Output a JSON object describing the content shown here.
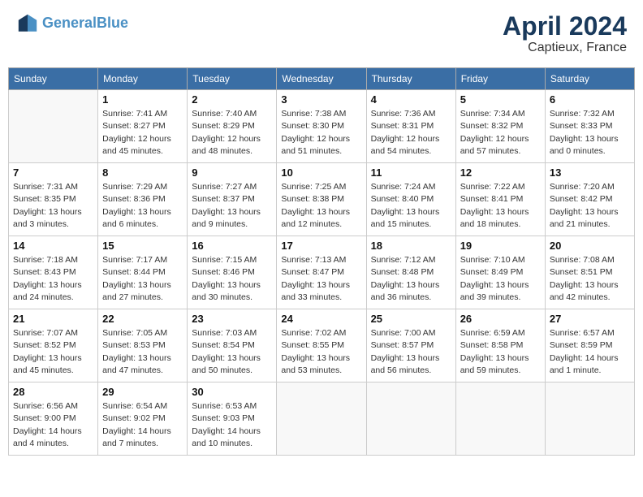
{
  "header": {
    "logo_line1": "General",
    "logo_line2": "Blue",
    "month_year": "April 2024",
    "location": "Captieux, France"
  },
  "weekdays": [
    "Sunday",
    "Monday",
    "Tuesday",
    "Wednesday",
    "Thursday",
    "Friday",
    "Saturday"
  ],
  "weeks": [
    [
      {
        "day": "",
        "info": ""
      },
      {
        "day": "1",
        "info": "Sunrise: 7:41 AM\nSunset: 8:27 PM\nDaylight: 12 hours\nand 45 minutes."
      },
      {
        "day": "2",
        "info": "Sunrise: 7:40 AM\nSunset: 8:29 PM\nDaylight: 12 hours\nand 48 minutes."
      },
      {
        "day": "3",
        "info": "Sunrise: 7:38 AM\nSunset: 8:30 PM\nDaylight: 12 hours\nand 51 minutes."
      },
      {
        "day": "4",
        "info": "Sunrise: 7:36 AM\nSunset: 8:31 PM\nDaylight: 12 hours\nand 54 minutes."
      },
      {
        "day": "5",
        "info": "Sunrise: 7:34 AM\nSunset: 8:32 PM\nDaylight: 12 hours\nand 57 minutes."
      },
      {
        "day": "6",
        "info": "Sunrise: 7:32 AM\nSunset: 8:33 PM\nDaylight: 13 hours\nand 0 minutes."
      }
    ],
    [
      {
        "day": "7",
        "info": "Sunrise: 7:31 AM\nSunset: 8:35 PM\nDaylight: 13 hours\nand 3 minutes."
      },
      {
        "day": "8",
        "info": "Sunrise: 7:29 AM\nSunset: 8:36 PM\nDaylight: 13 hours\nand 6 minutes."
      },
      {
        "day": "9",
        "info": "Sunrise: 7:27 AM\nSunset: 8:37 PM\nDaylight: 13 hours\nand 9 minutes."
      },
      {
        "day": "10",
        "info": "Sunrise: 7:25 AM\nSunset: 8:38 PM\nDaylight: 13 hours\nand 12 minutes."
      },
      {
        "day": "11",
        "info": "Sunrise: 7:24 AM\nSunset: 8:40 PM\nDaylight: 13 hours\nand 15 minutes."
      },
      {
        "day": "12",
        "info": "Sunrise: 7:22 AM\nSunset: 8:41 PM\nDaylight: 13 hours\nand 18 minutes."
      },
      {
        "day": "13",
        "info": "Sunrise: 7:20 AM\nSunset: 8:42 PM\nDaylight: 13 hours\nand 21 minutes."
      }
    ],
    [
      {
        "day": "14",
        "info": "Sunrise: 7:18 AM\nSunset: 8:43 PM\nDaylight: 13 hours\nand 24 minutes."
      },
      {
        "day": "15",
        "info": "Sunrise: 7:17 AM\nSunset: 8:44 PM\nDaylight: 13 hours\nand 27 minutes."
      },
      {
        "day": "16",
        "info": "Sunrise: 7:15 AM\nSunset: 8:46 PM\nDaylight: 13 hours\nand 30 minutes."
      },
      {
        "day": "17",
        "info": "Sunrise: 7:13 AM\nSunset: 8:47 PM\nDaylight: 13 hours\nand 33 minutes."
      },
      {
        "day": "18",
        "info": "Sunrise: 7:12 AM\nSunset: 8:48 PM\nDaylight: 13 hours\nand 36 minutes."
      },
      {
        "day": "19",
        "info": "Sunrise: 7:10 AM\nSunset: 8:49 PM\nDaylight: 13 hours\nand 39 minutes."
      },
      {
        "day": "20",
        "info": "Sunrise: 7:08 AM\nSunset: 8:51 PM\nDaylight: 13 hours\nand 42 minutes."
      }
    ],
    [
      {
        "day": "21",
        "info": "Sunrise: 7:07 AM\nSunset: 8:52 PM\nDaylight: 13 hours\nand 45 minutes."
      },
      {
        "day": "22",
        "info": "Sunrise: 7:05 AM\nSunset: 8:53 PM\nDaylight: 13 hours\nand 47 minutes."
      },
      {
        "day": "23",
        "info": "Sunrise: 7:03 AM\nSunset: 8:54 PM\nDaylight: 13 hours\nand 50 minutes."
      },
      {
        "day": "24",
        "info": "Sunrise: 7:02 AM\nSunset: 8:55 PM\nDaylight: 13 hours\nand 53 minutes."
      },
      {
        "day": "25",
        "info": "Sunrise: 7:00 AM\nSunset: 8:57 PM\nDaylight: 13 hours\nand 56 minutes."
      },
      {
        "day": "26",
        "info": "Sunrise: 6:59 AM\nSunset: 8:58 PM\nDaylight: 13 hours\nand 59 minutes."
      },
      {
        "day": "27",
        "info": "Sunrise: 6:57 AM\nSunset: 8:59 PM\nDaylight: 14 hours\nand 1 minute."
      }
    ],
    [
      {
        "day": "28",
        "info": "Sunrise: 6:56 AM\nSunset: 9:00 PM\nDaylight: 14 hours\nand 4 minutes."
      },
      {
        "day": "29",
        "info": "Sunrise: 6:54 AM\nSunset: 9:02 PM\nDaylight: 14 hours\nand 7 minutes."
      },
      {
        "day": "30",
        "info": "Sunrise: 6:53 AM\nSunset: 9:03 PM\nDaylight: 14 hours\nand 10 minutes."
      },
      {
        "day": "",
        "info": ""
      },
      {
        "day": "",
        "info": ""
      },
      {
        "day": "",
        "info": ""
      },
      {
        "day": "",
        "info": ""
      }
    ]
  ]
}
